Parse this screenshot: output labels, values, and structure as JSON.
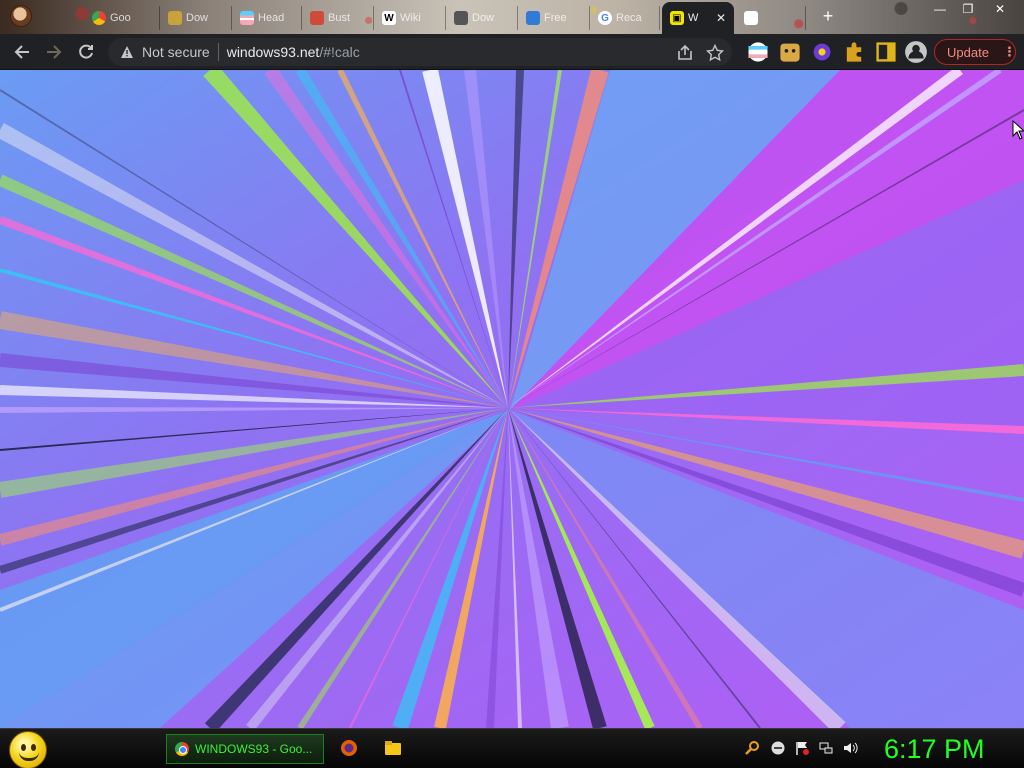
{
  "browser": {
    "tabs": [
      {
        "title": "Goo",
        "icon": "google-chrome-icon",
        "color": "#4285f4"
      },
      {
        "title": "Dow",
        "icon": "download-icon",
        "color": "#c8a23a"
      },
      {
        "title": "Head",
        "icon": "pride-flag-icon",
        "color": "#f5a9b8"
      },
      {
        "title": "Bust",
        "icon": "app-icon",
        "color": "#d04a3a"
      },
      {
        "title": "Wiki",
        "icon": "wikipedia-icon",
        "color": "#ffffff"
      },
      {
        "title": "Dow",
        "icon": "download-icon",
        "color": "#555555"
      },
      {
        "title": "Free",
        "icon": "home-icon",
        "color": "#2f7bd6"
      },
      {
        "title": "Reca",
        "icon": "google-icon",
        "color": "#4285f4"
      },
      {
        "title": "W",
        "icon": "windows93-icon",
        "color": "#f2e600",
        "active": true
      },
      {
        "title": "",
        "icon": "figure-icon",
        "color": "#ffffff"
      }
    ],
    "new_tab_label": "+",
    "window_controls": {
      "minimize": "—",
      "restore": "❐",
      "close": "✕"
    },
    "toolbar": {
      "not_secure_label": "Not secure",
      "url_host": "windows93.net",
      "url_path": "/#!calc",
      "update_label": "Update",
      "menu_label": "⋮"
    }
  },
  "page": {
    "background_colors": [
      "#5aa6f5",
      "#8c6ef2",
      "#a15cf3",
      "#c653f5"
    ]
  },
  "taskbar": {
    "task_item_label": "WINDOWS93 - Goo...",
    "clock": "6:17 PM",
    "clock_color": "#23ff23"
  }
}
